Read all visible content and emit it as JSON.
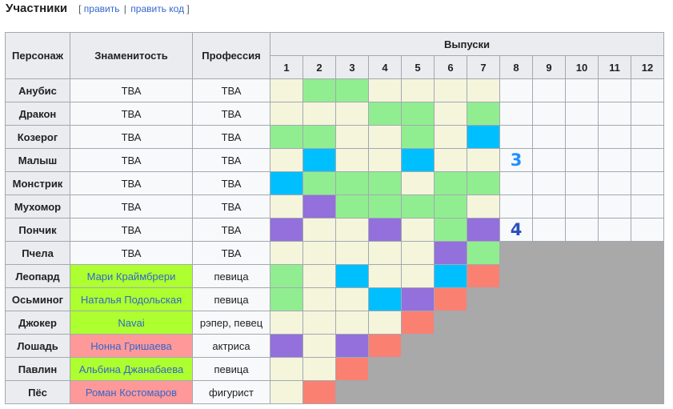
{
  "section": {
    "title": "Участники",
    "edit_label": "править",
    "edit_code_label": "править код",
    "bracket_open": "[",
    "bracket_close": "]",
    "separator": "|"
  },
  "table": {
    "headers": {
      "character": "Персонаж",
      "celebrity": "Знаменитость",
      "profession": "Профессия",
      "episodes": "Выпуски"
    },
    "episode_numbers": [
      "1",
      "2",
      "3",
      "4",
      "5",
      "6",
      "7",
      "8",
      "9",
      "10",
      "11",
      "12"
    ],
    "colors": {
      "G": "#90ee90",
      "B": "#00bfff",
      "P": "#9370db",
      "R": "#fa8072",
      "Y": "#f5f5dc",
      "E": "#f8f9fa",
      "X": "#a9a9a9",
      "celebrity_green": "#adff2f",
      "celebrity_red": "#ff9999",
      "place3": "#1e90ff",
      "place4": "#2b4fbf"
    },
    "rows": [
      {
        "character": "Анубис",
        "celebrity": "ТВА",
        "celebrity_style": "",
        "profession": "ТВА",
        "cells": [
          "Y",
          "G",
          "G",
          "Y",
          "Y",
          "Y",
          "Y",
          "E",
          "E",
          "E",
          "E",
          "E"
        ]
      },
      {
        "character": "Дракон",
        "celebrity": "ТВА",
        "celebrity_style": "",
        "profession": "ТВА",
        "cells": [
          "Y",
          "Y",
          "Y",
          "G",
          "G",
          "Y",
          "G",
          "E",
          "E",
          "E",
          "E",
          "E"
        ]
      },
      {
        "character": "Козерог",
        "celebrity": "ТВА",
        "celebrity_style": "",
        "profession": "ТВА",
        "cells": [
          "G",
          "G",
          "Y",
          "Y",
          "G",
          "Y",
          "B",
          "E",
          "E",
          "E",
          "E",
          "E"
        ]
      },
      {
        "character": "Малыш",
        "celebrity": "ТВА",
        "celebrity_style": "",
        "profession": "ТВА",
        "cells": [
          "Y",
          "B",
          "Y",
          "Y",
          "B",
          "Y",
          "Y",
          "3",
          "E",
          "E",
          "E",
          "E"
        ]
      },
      {
        "character": "Монстрик",
        "celebrity": "ТВА",
        "celebrity_style": "",
        "profession": "ТВА",
        "cells": [
          "B",
          "G",
          "G",
          "G",
          "Y",
          "G",
          "G",
          "E",
          "E",
          "E",
          "E",
          "E"
        ]
      },
      {
        "character": "Мухомор",
        "celebrity": "ТВА",
        "celebrity_style": "",
        "profession": "ТВА",
        "cells": [
          "Y",
          "P",
          "G",
          "G",
          "G",
          "G",
          "Y",
          "E",
          "E",
          "E",
          "E",
          "E"
        ]
      },
      {
        "character": "Пончик",
        "celebrity": "ТВА",
        "celebrity_style": "",
        "profession": "ТВА",
        "cells": [
          "P",
          "Y",
          "Y",
          "P",
          "Y",
          "G",
          "P",
          "4",
          "E",
          "E",
          "E",
          "E"
        ]
      },
      {
        "character": "Пчела",
        "celebrity": "ТВА",
        "celebrity_style": "",
        "profession": "ТВА",
        "cells": [
          "Y",
          "Y",
          "Y",
          "Y",
          "Y",
          "P",
          "G",
          "X",
          "X",
          "X",
          "X",
          "X"
        ]
      },
      {
        "character": "Леопард",
        "celebrity": "Мари Краймбрери",
        "celebrity_style": "green",
        "profession": "певица",
        "cells": [
          "G",
          "Y",
          "B",
          "Y",
          "Y",
          "B",
          "R",
          "X",
          "X",
          "X",
          "X",
          "X"
        ]
      },
      {
        "character": "Осьминог",
        "celebrity": "Наталья Подольская",
        "celebrity_style": "green",
        "profession": "певица",
        "cells": [
          "G",
          "Y",
          "Y",
          "B",
          "P",
          "R",
          "X",
          "X",
          "X",
          "X",
          "X",
          "X"
        ]
      },
      {
        "character": "Джокер",
        "celebrity": "Navai",
        "celebrity_style": "green",
        "profession": "рэпер, певец",
        "cells": [
          "Y",
          "Y",
          "Y",
          "Y",
          "R",
          "X",
          "X",
          "X",
          "X",
          "X",
          "X",
          "X"
        ]
      },
      {
        "character": "Лошадь",
        "celebrity": "Нонна Гришаева",
        "celebrity_style": "red",
        "profession": "актриса",
        "cells": [
          "P",
          "Y",
          "P",
          "R",
          "X",
          "X",
          "X",
          "X",
          "X",
          "X",
          "X",
          "X"
        ]
      },
      {
        "character": "Павлин",
        "celebrity": "Альбина Джанабаева",
        "celebrity_style": "green",
        "profession": "певица",
        "cells": [
          "Y",
          "Y",
          "R",
          "X",
          "X",
          "X",
          "X",
          "X",
          "X",
          "X",
          "X",
          "X"
        ]
      },
      {
        "character": "Пёс",
        "celebrity": "Роман Костомаров",
        "celebrity_style": "red",
        "profession": "фигурист",
        "cells": [
          "Y",
          "R",
          "X",
          "X",
          "X",
          "X",
          "X",
          "X",
          "X",
          "X",
          "X",
          "X"
        ]
      }
    ]
  }
}
